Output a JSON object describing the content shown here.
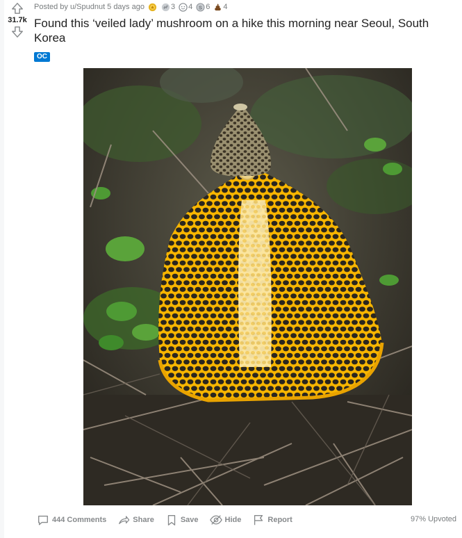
{
  "post": {
    "score": "31.7k",
    "posted_by": "Posted by u/Spudnut",
    "time_ago": "5 days ago",
    "title": "Found this ‘veiled lady’ mushroom on a hike this morning near Seoul, South Korea",
    "flair": "OC",
    "upvoted": "97% Upvoted"
  },
  "awards": [
    {
      "icon": "gold-award-icon",
      "count": ""
    },
    {
      "icon": "helpful-award-icon",
      "count": "3"
    },
    {
      "icon": "wholesome-award-icon",
      "count": "4"
    },
    {
      "icon": "silver-award-icon",
      "count": "6"
    },
    {
      "icon": "poop-award-icon",
      "count": "4"
    }
  ],
  "actions": {
    "comments": "444 Comments",
    "share": "Share",
    "save": "Save",
    "hide": "Hide",
    "report": "Report"
  },
  "colors": {
    "flair_bg": "#0079d3",
    "meta_text": "#787c7e",
    "action_text": "#878a8c",
    "veil": "#f5a800"
  }
}
